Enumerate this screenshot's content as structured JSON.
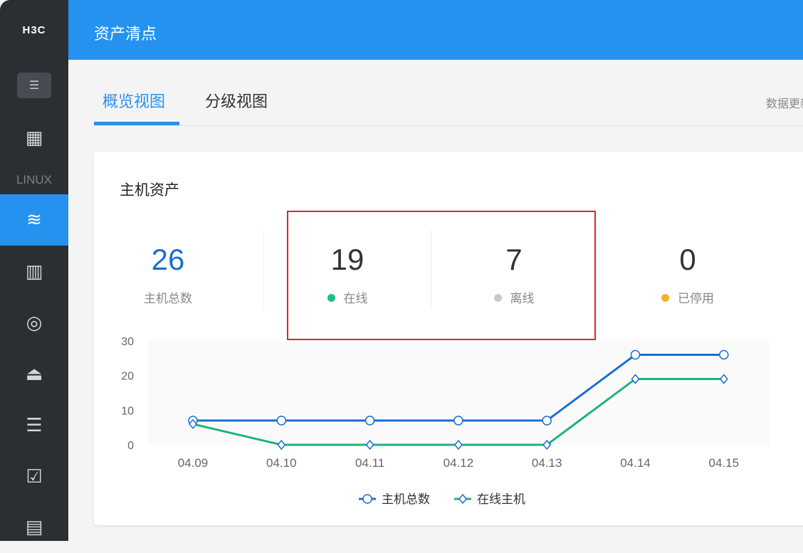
{
  "sidebar": {
    "logo": "H3C",
    "menu_icon": "menu-collapse-icon",
    "section": "LINUX",
    "items": [
      {
        "icon": "grid-icon",
        "glyph": "▦"
      },
      {
        "icon": "layers-icon",
        "glyph": "≋",
        "active": true
      },
      {
        "icon": "server-columns-icon",
        "glyph": "▥"
      },
      {
        "icon": "radar-icon",
        "glyph": "◎"
      },
      {
        "icon": "alarm-icon",
        "glyph": "⏏"
      },
      {
        "icon": "share-list-icon",
        "glyph": "☰"
      },
      {
        "icon": "checklist-icon",
        "glyph": "☑"
      },
      {
        "icon": "documents-icon",
        "glyph": "▤"
      }
    ]
  },
  "header": {
    "title": "资产清点"
  },
  "tabs": [
    {
      "label": "概览视图",
      "active": true
    },
    {
      "label": "分级视图"
    }
  ],
  "update_text": "数据更新",
  "card": {
    "title": "主机资产",
    "stats": [
      {
        "value": "26",
        "label": "主机总数",
        "color": "#1a6fd1"
      },
      {
        "value": "19",
        "label": "在线",
        "dot": "#1fbf86"
      },
      {
        "value": "7",
        "label": "离线",
        "dot": "#c8c8c8"
      },
      {
        "value": "0",
        "label": "已停用",
        "dot": "#f0b429"
      }
    ]
  },
  "colors": {
    "accent": "#2592f0",
    "highlight": "#e4212b"
  },
  "chart_data": {
    "type": "line",
    "categories": [
      "04.09",
      "04.10",
      "04.11",
      "04.12",
      "04.13",
      "04.14",
      "04.15"
    ],
    "ylim": [
      0,
      30
    ],
    "yticks": [
      0,
      10,
      20,
      30
    ],
    "legend": "bottom",
    "series": [
      {
        "name": "主机总数",
        "values": [
          7,
          7,
          7,
          7,
          7,
          26,
          26
        ],
        "color": "#1a6fd1",
        "marker": "circle"
      },
      {
        "name": "在线主机",
        "values": [
          6,
          0,
          0,
          0,
          0,
          19,
          19
        ],
        "color": "#1fb37a",
        "marker": "diamond"
      }
    ]
  }
}
